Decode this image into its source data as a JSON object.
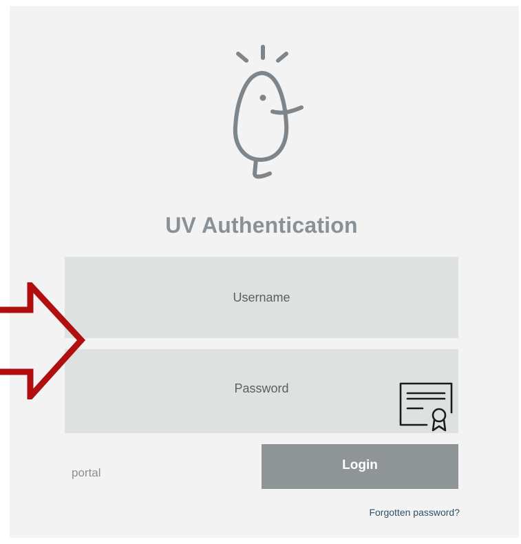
{
  "auth": {
    "title": "UV Authentication",
    "username_placeholder": "Username",
    "password_placeholder": "Password",
    "login_label": "Login",
    "portal_label": "portal",
    "forgot_label": "Forgotten password?"
  },
  "icons": {
    "logo": "bird-mascot-logo-icon",
    "certificate": "certificate-icon",
    "annotation_arrow": "red-arrow-icon"
  },
  "colors": {
    "panel_background": "#f3f3f3",
    "field_background": "#dde1df",
    "title": "#8a9196",
    "login_button": "#8f9497",
    "arrow": "#b10f0f",
    "link": "#2f4f66"
  }
}
